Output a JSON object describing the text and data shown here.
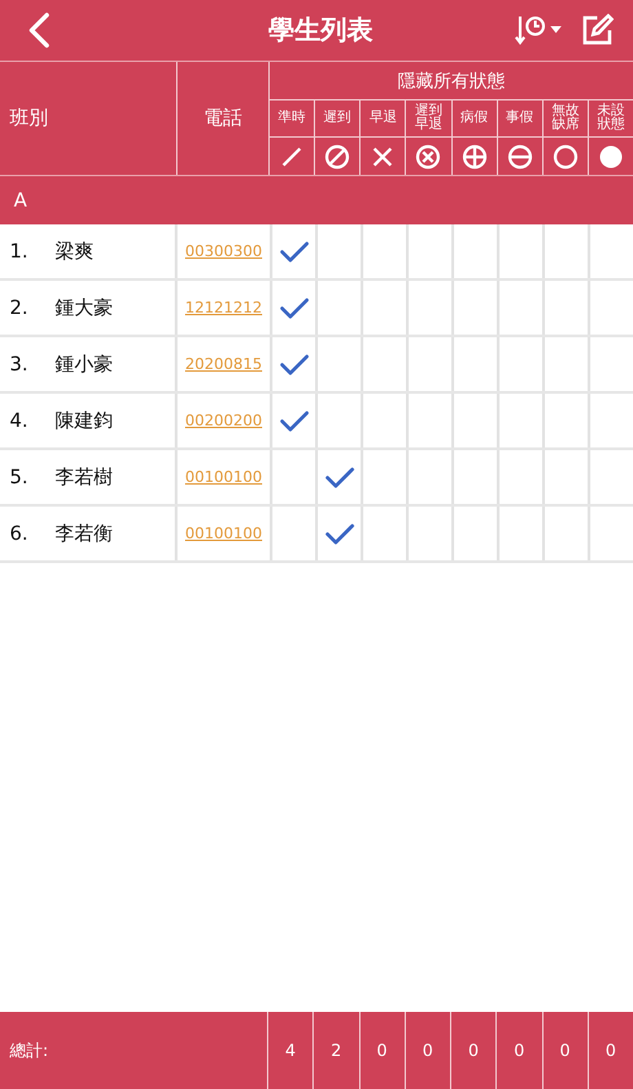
{
  "nav": {
    "title": "學生列表"
  },
  "header": {
    "class_label": "班別",
    "phone_label": "電話",
    "hide_all": "隱藏所有狀態",
    "statuses": [
      {
        "label": "準時",
        "kind": "slash"
      },
      {
        "label": "遲到",
        "kind": "no"
      },
      {
        "label": "早退",
        "kind": "cross"
      },
      {
        "label": "遲到早退",
        "kind": "circle-cross"
      },
      {
        "label": "病假",
        "kind": "circle-plus"
      },
      {
        "label": "事假",
        "kind": "circle-minus"
      },
      {
        "label": "無故缺席",
        "kind": "circle"
      },
      {
        "label": "未設狀態",
        "kind": "dot"
      }
    ]
  },
  "section": "A",
  "rows": [
    {
      "number": "1.",
      "name": "梁爽",
      "phone": "00300300",
      "checks": [
        true,
        false,
        false,
        false,
        false,
        false,
        false,
        false
      ]
    },
    {
      "number": "2.",
      "name": "鍾大豪",
      "phone": "12121212",
      "checks": [
        true,
        false,
        false,
        false,
        false,
        false,
        false,
        false
      ]
    },
    {
      "number": "3.",
      "name": "鍾小豪",
      "phone": "20200815",
      "checks": [
        true,
        false,
        false,
        false,
        false,
        false,
        false,
        false
      ]
    },
    {
      "number": "4.",
      "name": "陳建鈞",
      "phone": "00200200",
      "checks": [
        true,
        false,
        false,
        false,
        false,
        false,
        false,
        false
      ]
    },
    {
      "number": "5.",
      "name": "李若樹",
      "phone": "00100100",
      "checks": [
        false,
        true,
        false,
        false,
        false,
        false,
        false,
        false
      ]
    },
    {
      "number": "6.",
      "name": "李若衡",
      "phone": "00100100",
      "checks": [
        false,
        true,
        false,
        false,
        false,
        false,
        false,
        false
      ]
    }
  ],
  "footer": {
    "label": "總計:",
    "totals": [
      "4",
      "2",
      "0",
      "0",
      "0",
      "0",
      "0",
      "0"
    ]
  }
}
